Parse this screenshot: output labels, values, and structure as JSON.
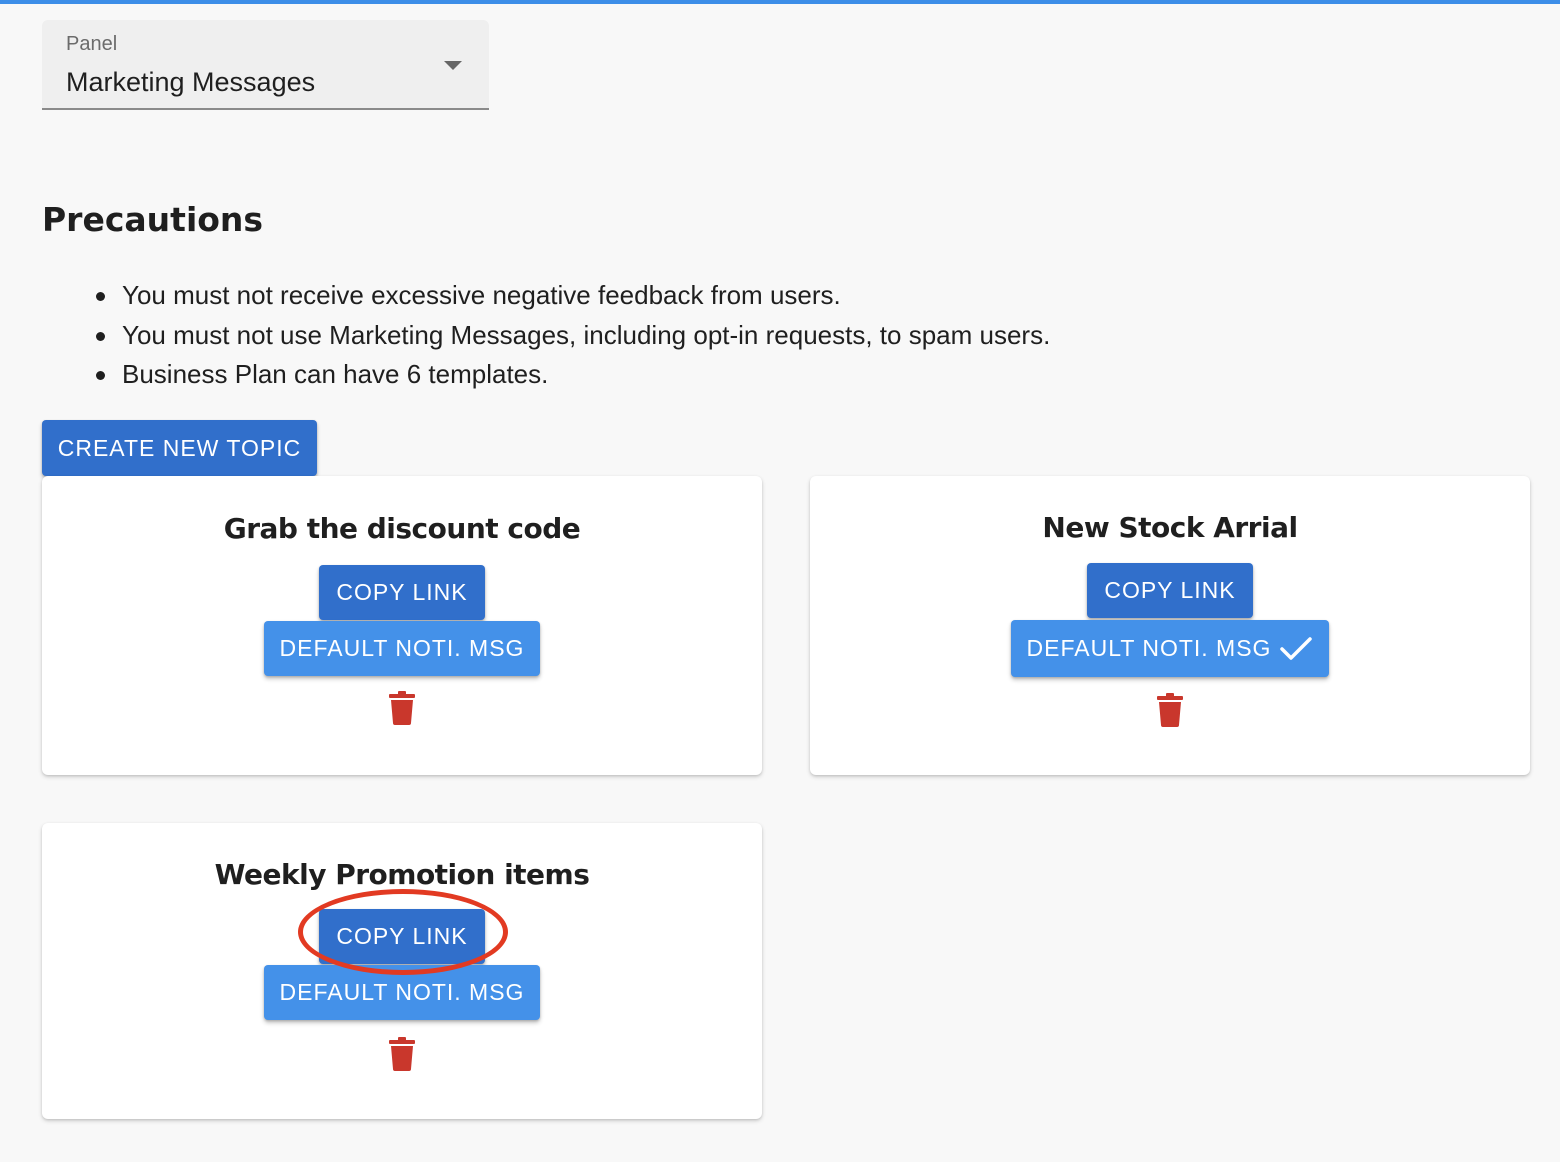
{
  "panel_select": {
    "label": "Panel",
    "value": "Marketing Messages"
  },
  "precautions": {
    "title": "Precautions",
    "items": [
      "You must not receive excessive negative feedback from users.",
      "You must not use Marketing Messages, including opt-in requests, to spam users.",
      "Business Plan can have 6 templates."
    ]
  },
  "create_button": "CREATE NEW TOPIC",
  "topics": [
    {
      "title": "Grab the discount code",
      "copy_label": "COPY LINK",
      "default_label": "DEFAULT NOTI. MSG",
      "is_default": false
    },
    {
      "title": "New Stock Arrial",
      "copy_label": "COPY LINK",
      "default_label": "DEFAULT NOTI. MSG",
      "is_default": true
    },
    {
      "title": "Weekly Promotion items",
      "copy_label": "COPY LINK",
      "default_label": "DEFAULT NOTI. MSG",
      "is_default": false
    }
  ],
  "colors": {
    "accent_dark": "#316fcb",
    "accent_light": "#4491e9",
    "delete_red": "#c9372c",
    "annotation_red": "#e23a22"
  },
  "icons": {
    "dropdown": "chevron-down-icon",
    "delete": "trash-icon",
    "default_marker": "check-icon"
  }
}
